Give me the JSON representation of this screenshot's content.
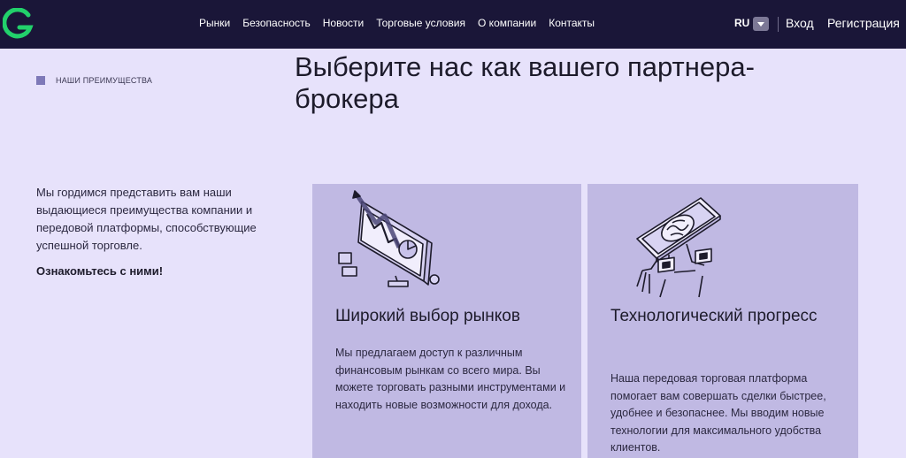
{
  "header": {
    "logo_letter": "G",
    "nav": [
      "Рынки",
      "Безопасность",
      "Новости",
      "Торговые условия",
      "О компании",
      "Контакты"
    ],
    "language": "RU",
    "login": "Вход",
    "register": "Регистрация"
  },
  "section": {
    "label": "НАШИ ПРЕИМУЩЕСТВА",
    "headline": "Выберите нас как вашего партнера-брокера",
    "intro": "Мы гордимся представить вам наши выдающиеся преимущества компании и передовой платформы, способствующие успешной торговле.",
    "intro_link": "Ознакомьтесь с ними!"
  },
  "cards": [
    {
      "title": "Широкий выбор рынков",
      "text": "Мы предлагаем доступ к различным финансовым рынкам со всего мира. Вы можете торговать разными инструментами и находить новые возможности для дохода."
    },
    {
      "title": "Технологический прогресс",
      "text": "Наша передовая торговая платформа помогает вам совершать сделки быстрее, удобнее и безопаснее. Мы вводим новые технологии для максимального удобства клиентов."
    }
  ],
  "colors": {
    "header_bg": "#1a1638",
    "page_bg": "#e7e2fb",
    "card_bg": "#c0b9e3",
    "logo_green": "#22d16b"
  }
}
